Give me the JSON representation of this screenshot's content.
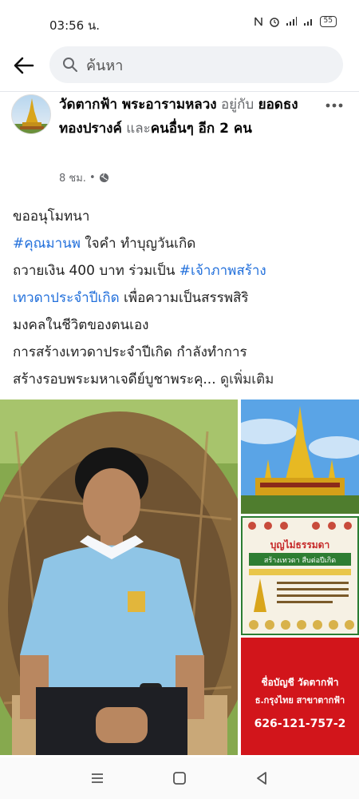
{
  "status": {
    "time": "03:56 น.",
    "battery": "55"
  },
  "search": {
    "placeholder": "ค้นหา"
  },
  "post": {
    "page_name": "วัดตากฟ้า พระอารามหลวง",
    "with_word": "อยู่กับ",
    "tagged_user": "ยอดธง ทองปรางค์",
    "and_word": "และ",
    "others": "คนอื่นๆ อีก 2 คน",
    "time_ago": "8 ชม.",
    "body": {
      "l1": "ขออนุโมทนา",
      "l2_tag": "#คุณมานพ",
      "l2_rest": " ใจคำ ทำบุญวันเกิด",
      "l3_text": " ถวายเงิน 400 บาท ร่วมเป็น ",
      "l3_tag": "#เจ้าภาพสร้าง",
      "l4_tag": "เทวดาประจำปีเกิด",
      "l4_rest": "  เพื่อความเป็นสรรพสิริ",
      "l5": "มงคลในชีวิตของตนเอง",
      "l6": "  การสร้างเทวดาประจำปีเกิด กำลังทำการ",
      "l7": "สร้างรอบพระมหาเจดีย์บูชาพระคุ...",
      "see_more": "ดูเพิ่มเติม"
    }
  },
  "photos": {
    "poster_title": "บุญไม่ธรรมดา",
    "poster_sub": "สร้างเทวดา สืบต่อปีเกิด",
    "account_line1": "ชื่อบัญชี วัดตากฟ้า",
    "account_line2": "ธ.กรุงไทย สาขาตากฟ้า",
    "account_number": "626-121-757-2"
  },
  "icons": [
    "back-arrow-icon",
    "search-icon",
    "globe-icon",
    "more-icon",
    "recents-icon",
    "home-icon",
    "back-icon"
  ]
}
